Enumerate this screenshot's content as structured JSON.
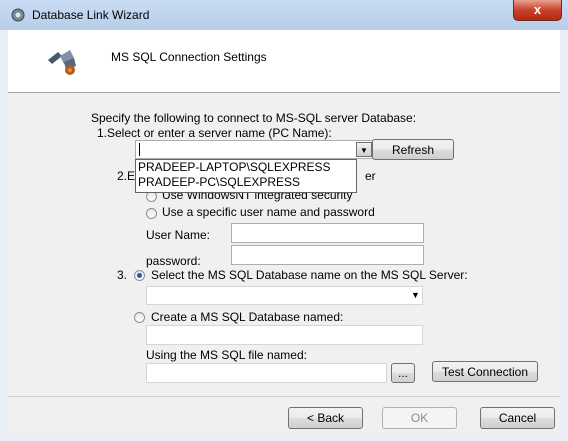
{
  "window": {
    "title": "Database Link Wizard",
    "close_glyph": "x"
  },
  "header": {
    "title": "MS SQL Connection Settings",
    "icon": "database-connector-icon"
  },
  "instructions": "Specify the following to connect to MS-SQL server Database:",
  "step1": {
    "label": "1.Select or enter a server name (PC Name):",
    "server_value": "",
    "refresh_label": "Refresh",
    "options": [
      "PRADEEP-LAPTOP\\SQLEXPRESS",
      "PRADEEP-PC\\SQLEXPRESS"
    ]
  },
  "step2": {
    "label_prefix": "2.E",
    "label_suffix": "er",
    "windows_auth_label": "Use WindowsNT integrated security",
    "specific_user_label": "Use a specific user name and password",
    "username_label": "User Name:",
    "password_label": "password:",
    "username_value": "",
    "password_value": ""
  },
  "step3": {
    "number": "3.",
    "select_db_label": "Select the MS SQL Database name on the MS SQL Server:",
    "create_db_label": "Create a MS SQL Database named:",
    "file_label": "Using the MS SQL file named:",
    "browse_label": "...",
    "test_label": "Test Connection"
  },
  "footer": {
    "back_label": "< Back",
    "ok_label": "OK",
    "cancel_label": "Cancel"
  }
}
